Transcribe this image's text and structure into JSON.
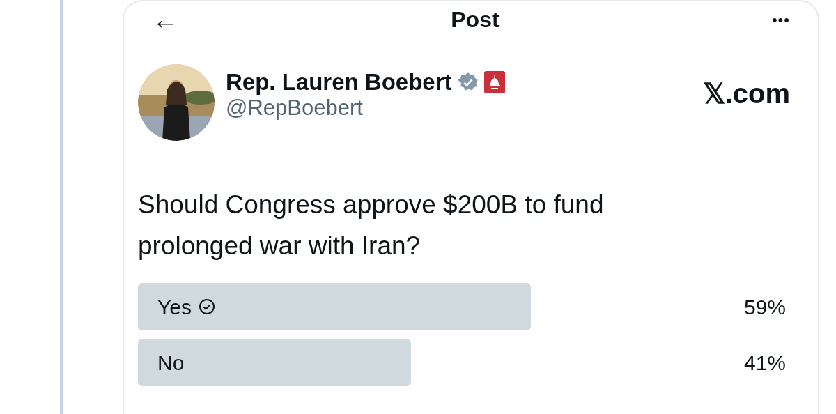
{
  "header": {
    "back": "←",
    "title": "Post",
    "more": "•••"
  },
  "author": {
    "name": "Rep. Lauren Boebert",
    "handle": "@RepBoebert",
    "verified": true
  },
  "watermark_site": "𝕏.com",
  "text": "Should Congress approve $200B to fund prolonged war with Iran?",
  "poll": [
    {
      "label": "Yes",
      "selected": true,
      "level": 0.59,
      "percent": "59%"
    },
    {
      "label": "No",
      "selected": false,
      "level": 0.41,
      "percent": "41%"
    }
  ]
}
